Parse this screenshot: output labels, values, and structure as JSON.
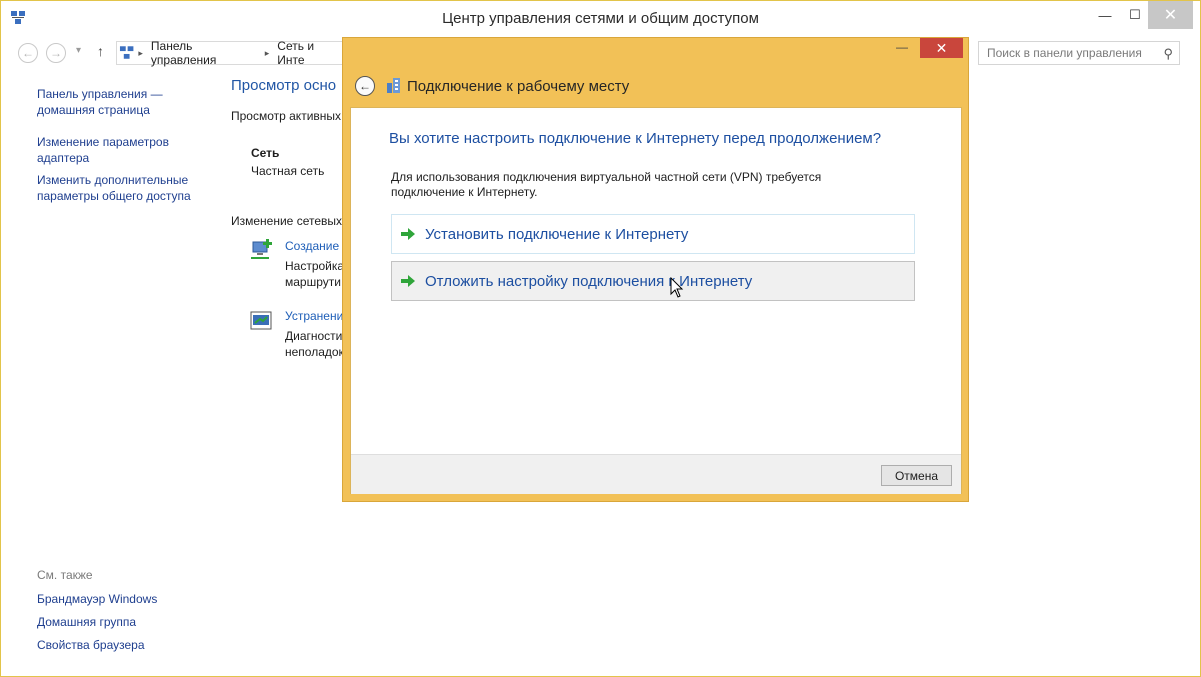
{
  "window": {
    "title": "Центр управления сетями и общим доступом",
    "minimize": "—",
    "maximize": "☐",
    "close": "✕"
  },
  "address_bar": {
    "back": "←",
    "forward": "→",
    "dropdown": "▾",
    "up": "↑",
    "crumbs": [
      "Панель управления",
      "Сеть и Инте"
    ],
    "crumb_separator": "▸"
  },
  "search": {
    "placeholder": "Поиск в панели управления",
    "icon_glyph": "⚲"
  },
  "sidebar": {
    "links": [
      "Панель управления —\nдомашняя страница",
      "Изменение параметров\nадаптера",
      "Изменить дополнительные\nпараметры общего доступа"
    ],
    "see_also_heading": "См. также",
    "see_also_links": [
      "Брандмауэр Windows",
      "Домашняя группа",
      "Свойства браузера"
    ]
  },
  "main": {
    "heading": "Просмотр осно",
    "active_networks_label": "Просмотр активных",
    "network_name": "Сеть",
    "network_type": "Частная сеть",
    "change_settings_label": "Изменение сетевых",
    "tasks": [
      {
        "link": "Создание и",
        "desc": "Настройка\nмаршрути"
      },
      {
        "link": "Устранени",
        "desc": "Диагности\nнеполадок"
      }
    ]
  },
  "dialog": {
    "title": "Подключение к рабочему месту",
    "minimize": "—",
    "maximize": "☐",
    "close": "✕",
    "back": "←",
    "question": "Вы хотите настроить подключение к Интернету перед продолжением?",
    "description": "Для использования подключения виртуальной частной сети (VPN) требуется подключение к Интернету.",
    "options": [
      "Установить подключение к Интернету",
      "Отложить настройку подключения к Интернету"
    ],
    "cancel_label": "Отмена"
  },
  "colors": {
    "dialog_frame": "#f2c157",
    "link_blue": "#1d4fa1",
    "close_red": "#c9463c",
    "arrow_green": "#2fa53a"
  }
}
